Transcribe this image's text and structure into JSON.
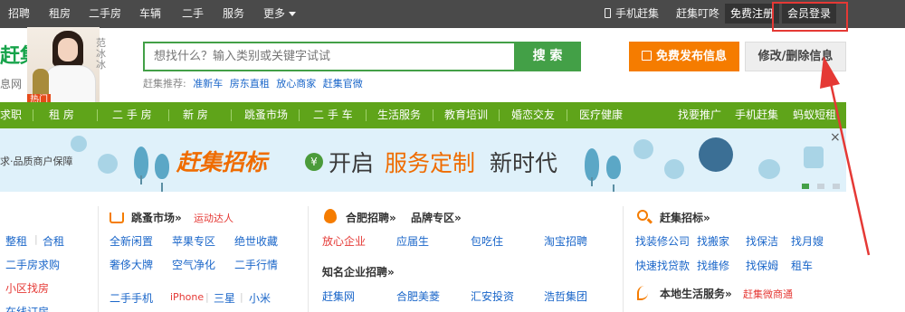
{
  "topbar": {
    "links": [
      "招聘",
      "租房",
      "二手房",
      "车辆",
      "二手",
      "服务"
    ],
    "more": "更多",
    "mobile": "手机赶集",
    "dingdong": "赶集叮咚",
    "register": "免费注册",
    "login": "会员登录"
  },
  "header": {
    "logo_text": "赶集",
    "logo_sub": "息网",
    "hot_badge": "热门",
    "celebrity_name": "范冰冰",
    "search_placeholder": "想找什么？输入类别或关键字试试",
    "search_button": "搜 索",
    "hot_label": "赶集推荐:",
    "hot_links": [
      "准新车",
      "房东直租",
      "放心商家",
      "赶集官微"
    ],
    "post_button": "免费发布信息",
    "edit_button": "修改/删除信息"
  },
  "nav": {
    "items": [
      "求职",
      "租 房",
      "二 手 房",
      "新 房",
      "跳蚤市场",
      "二 手 车",
      "生活服务",
      "教育培训",
      "婚恋交友",
      "医疗健康"
    ],
    "right_items": [
      "找要推广",
      "手机赶集",
      "蚂蚁短租"
    ]
  },
  "banner": {
    "left_text": "求·品质商户保障",
    "title": "赶集招标",
    "slogan_a": "开启",
    "slogan_b": "服务定制",
    "slogan_c": "新时代",
    "close": "×",
    "yen": "¥"
  },
  "col1": {
    "rows": [
      [
        "整租",
        "合租"
      ],
      [
        "二手房求购"
      ],
      [
        "小区找房"
      ],
      [
        "在线订房"
      ]
    ]
  },
  "col2": {
    "head": "跳蚤市场»",
    "tag": "运动达人",
    "links_row1": [
      "全新闲置",
      "苹果专区",
      "绝世收藏"
    ],
    "links_row2": [
      "奢侈大牌",
      "空气净化",
      "二手行情"
    ],
    "links_row3a": "二手手机",
    "links_row3_red": "iPhone",
    "links_row3b": [
      "三星",
      "小米"
    ]
  },
  "col3": {
    "head_a": "合肥招聘»",
    "head_b": "品牌专区»",
    "links_row1_red": "放心企业",
    "links_row1": [
      "应届生",
      "包吃住",
      "淘宝招聘"
    ],
    "head_c": "知名企业招聘»",
    "links_row2": [
      "赶集网",
      "合肥美菱",
      "汇安投资",
      "浩哲集团"
    ]
  },
  "col4": {
    "head": "赶集招标»",
    "links_row1": [
      "找装修公司",
      "找搬家",
      "找保洁",
      "找月嫂"
    ],
    "links_row2": [
      "快速找贷款",
      "找维修",
      "找保姆",
      "租车"
    ],
    "head_b": "本地生活服务»",
    "head_b_red": "赶集微商通"
  },
  "colors": {
    "topbar": "#4a4a4a",
    "brand_green": "#43a047",
    "nav_green": "#5fa41a",
    "orange": "#f57c00",
    "link_blue": "#1a66c9",
    "annotation_red": "#e53935"
  }
}
